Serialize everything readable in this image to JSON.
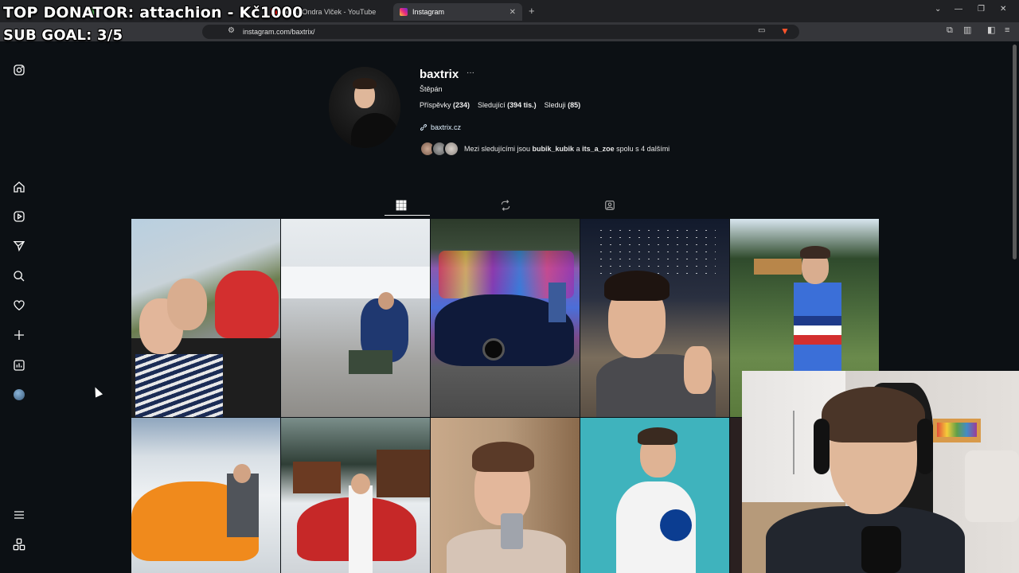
{
  "browser": {
    "tabs": [
      {
        "label": "",
        "active": false
      },
      {
        "label": "",
        "active": false
      },
      {
        "label": "(491) Ondra Vlček - YouTube",
        "active": false
      },
      {
        "label": "Instagram",
        "active": true
      }
    ],
    "url": "instagram.com/baxtrix/"
  },
  "overlay": {
    "top_donator": "TOP DONATOR: attachion - Kč1000",
    "sub_goal": "SUB GOAL: 3/5"
  },
  "sidebar": {
    "icons": [
      "instagram-logo-icon",
      "home-icon",
      "reels-icon",
      "messages-icon",
      "search-icon",
      "notifications-icon",
      "create-icon",
      "dashboard-icon",
      "profile-avatar",
      "menu-icon",
      "more-apps-icon"
    ]
  },
  "profile": {
    "username": "baxtrix",
    "more": "···",
    "full_name": "Štěpán",
    "stats": [
      {
        "label": "Příspěvky",
        "value": "(234)"
      },
      {
        "label": "Sledující",
        "value": "(394 tis.)"
      },
      {
        "label": "Sleduji",
        "value": "(85)"
      }
    ],
    "link": "baxtrix.cz",
    "mutual": {
      "prefix": "Mezi sledujícími jsou",
      "user1": "bubik_kubik",
      "conj": "a",
      "user2": "its_a_zoe",
      "suffix": "spolu s 4 dalšími"
    }
  },
  "profile_tabs": [
    "posts-grid-icon",
    "reposts-icon",
    "tagged-icon"
  ],
  "colors": {
    "background": "#0c1014",
    "link": "#e0f1ff",
    "accent_red": "#d32f2f",
    "instagram_tab": "#e1306c",
    "youtube_red": "#ff0000"
  }
}
